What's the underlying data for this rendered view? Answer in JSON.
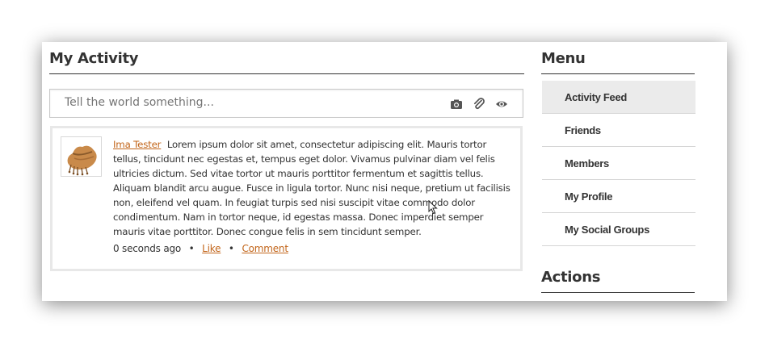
{
  "main": {
    "title": "My Activity",
    "composer": {
      "placeholder": "Tell the world something...",
      "icons": [
        "camera-icon",
        "paperclip-icon",
        "eye-icon"
      ]
    },
    "post": {
      "author": "Ima Tester",
      "body": "Lorem ipsum dolor sit amet, consectetur adipiscing elit. Mauris tortor tellus, tincidunt nec egestas et, tempus eget dolor. Vivamus pulvinar diam vel felis ultricies dictum. Sed vitae tortor ut mauris porttitor fermentum et sagittis tellus. Aliquam blandit arcu augue. Fusce in ligula tortor. Nunc nisi neque, pretium ut facilisis non, eleifend vel quam. In feugiat turpis sed nisi suscipit vitae commodo dolor condimentum. Nam in tortor neque, id egestas massa. Donec imperdiet semper mauris vitae porttitor. Donec congue felis in sem tincidunt semper.",
      "timestamp": "0 seconds ago",
      "separator": "•",
      "like_label": "Like",
      "comment_label": "Comment"
    }
  },
  "sidebar": {
    "menu_title": "Menu",
    "items": [
      {
        "label": "Activity Feed",
        "active": true
      },
      {
        "label": "Friends",
        "active": false
      },
      {
        "label": "Members",
        "active": false
      },
      {
        "label": "My Profile",
        "active": false
      },
      {
        "label": "My Social Groups",
        "active": false
      }
    ],
    "actions_title": "Actions"
  },
  "colors": {
    "link": "#c2651a",
    "active_menu_bg": "#ebebeb",
    "text": "#333333"
  }
}
